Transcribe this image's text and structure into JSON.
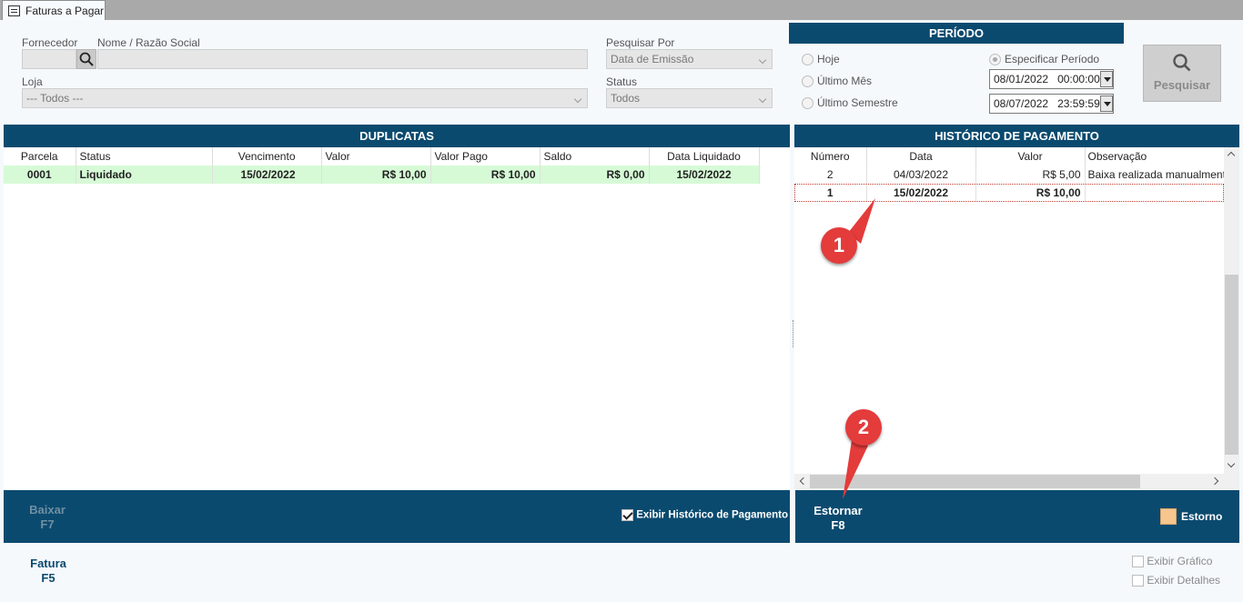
{
  "tab": {
    "title": "Faturas a Pagar"
  },
  "filters": {
    "fornecedor_label": "Fornecedor",
    "fornecedor_value": "",
    "razao_label": "Nome / Razão Social",
    "razao_value": "",
    "loja_label": "Loja",
    "loja_value": "--- Todos ---",
    "pesquisar_por_label": "Pesquisar Por",
    "pesquisar_por_value": "Data de Emissão",
    "status_label": "Status",
    "status_value": "Todos"
  },
  "periodo": {
    "title": "PERÍODO",
    "options": [
      "Hoje",
      "Último Mês",
      "Último Semestre",
      "Especificar Período"
    ],
    "selected": "Especificar Período",
    "start_date": "08/01/2022",
    "start_time": "00:00:00",
    "end_date": "08/07/2022",
    "end_time": "23:59:59"
  },
  "search_button": {
    "label": "Pesquisar"
  },
  "duplicatas": {
    "title": "DUPLICATAS",
    "columns": [
      "Parcela",
      "Status",
      "Vencimento",
      "Valor",
      "Valor Pago",
      "Saldo",
      "Data Liquidado"
    ],
    "rows": [
      [
        "0001",
        "Liquidado",
        "15/02/2022",
        "R$ 10,00",
        "R$ 10,00",
        "R$ 0,00",
        "15/02/2022"
      ]
    ]
  },
  "historico": {
    "title": "HISTÓRICO DE PAGAMENTO",
    "columns": [
      "Número",
      "Data",
      "Valor",
      "Observação"
    ],
    "rows": [
      [
        "2",
        "04/03/2022",
        "R$ 5,00",
        "Baixa realizada manualment"
      ],
      [
        "1",
        "15/02/2022",
        "R$ 10,00",
        ""
      ]
    ]
  },
  "actions": {
    "baixar_label": "Baixar",
    "baixar_key": "F7",
    "exibir_historico": "Exibir Histórico de Pagamento",
    "estornar_label": "Estornar",
    "estornar_key": "F8",
    "estorno_legend": "Estorno",
    "estorno_color": "#f7c58e",
    "fatura_label": "Fatura",
    "fatura_key": "F5",
    "exibir_grafico": "Exibir Gráfico",
    "exibir_detalhes": "Exibir Detalhes"
  },
  "annotations": {
    "marker1": "1",
    "marker2": "2"
  },
  "colors": {
    "header": "#0b4a6f",
    "liquidado_row": "#d6fad6",
    "marker": "#e43b3b"
  }
}
